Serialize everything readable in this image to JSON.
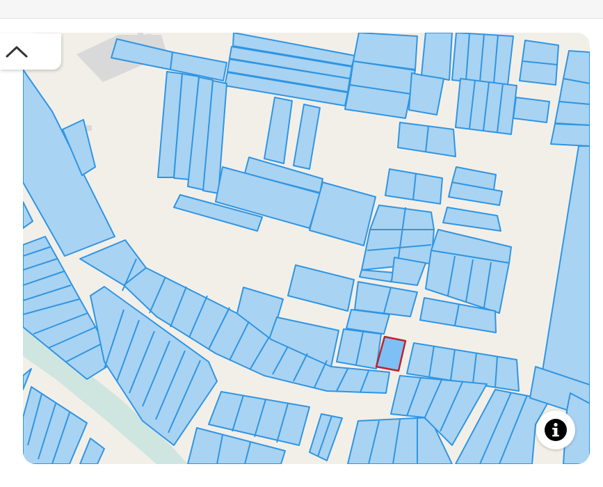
{
  "map": {
    "parcel_fill": "#a9d3f2",
    "parcel_stroke": "#2f95e3",
    "selected_fill": "#7cc0f5",
    "selected_stroke": "#c0212b",
    "background": "#f2efe9",
    "canal_color": "#cfe5e0",
    "building_color": "#d9d9d9"
  },
  "controls": {
    "collapse_icon": "chevron-up-icon",
    "info_icon": "info-icon",
    "info_glyph": "i"
  }
}
